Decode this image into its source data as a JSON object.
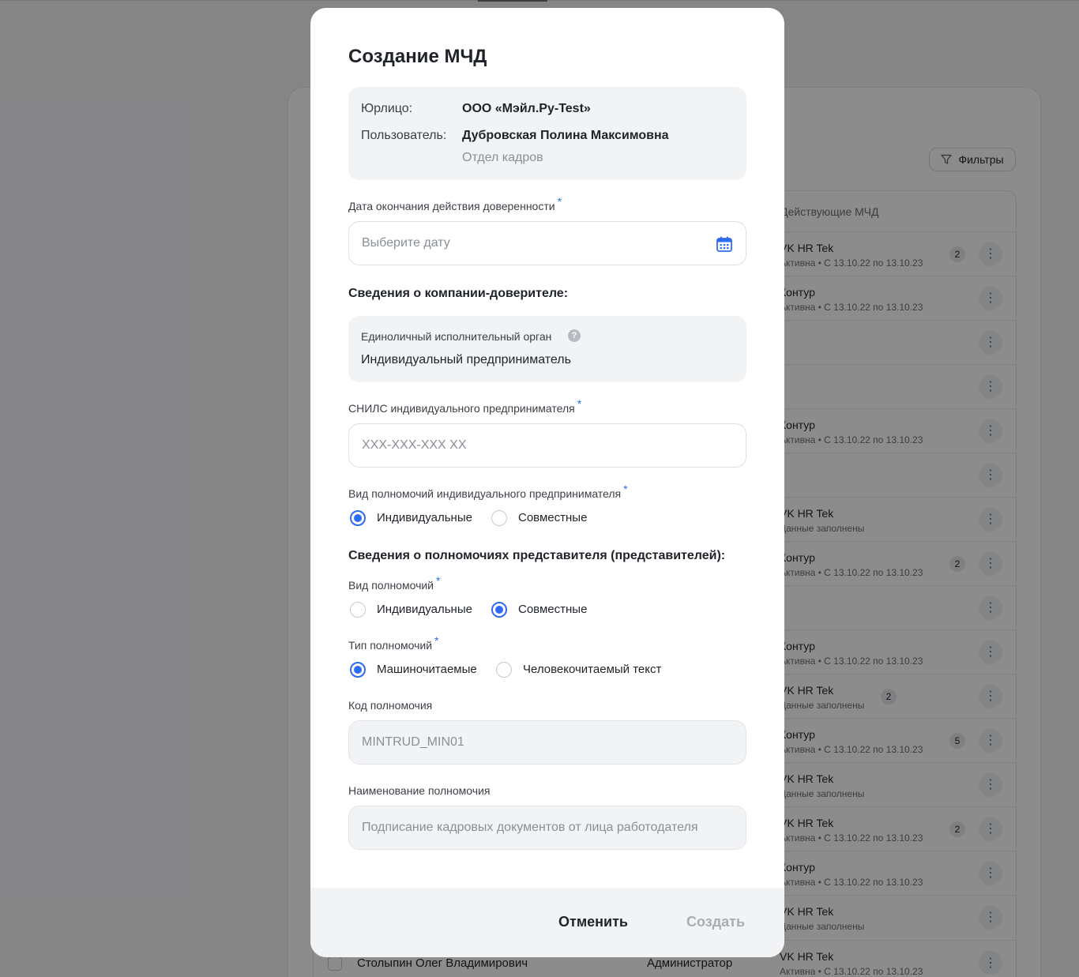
{
  "background": {
    "filter_label": "Фильтры",
    "column_header": "Действующие МЧД",
    "rows": [
      {
        "org": "VK HR Tek",
        "status": "Активна",
        "period": "С 13.10.22 по 13.10.23",
        "badge": "2"
      },
      {
        "org": "Контур",
        "status": "Активна",
        "period": "С 13.10.22 по 13.10.23",
        "badge": ""
      },
      {
        "org": "",
        "status": "",
        "period": "",
        "badge": ""
      },
      {
        "org": "",
        "status": "",
        "period": "",
        "badge": ""
      },
      {
        "org": "Контур",
        "status": "Активна",
        "period": "С 13.10.22 по 13.10.23",
        "badge": ""
      },
      {
        "org": "",
        "status": "",
        "period": "",
        "badge": ""
      },
      {
        "org": "VK HR Tek",
        "status": "Данные заполнены",
        "period": "",
        "badge": ""
      },
      {
        "org": "Контур",
        "status": "Активна",
        "period": "С 13.10.22 по 13.10.23",
        "badge": "2"
      },
      {
        "org": "",
        "status": "",
        "period": "",
        "badge": ""
      },
      {
        "org": "Контур",
        "status": "Активна",
        "period": "С 13.10.22 по 13.10.23",
        "badge": ""
      },
      {
        "org": "VK HR Tek",
        "status": "Данные заполнены",
        "period": "",
        "badge": "2"
      },
      {
        "org": "Контур",
        "status": "Активна",
        "period": "С 13.10.22 по 13.10.23",
        "badge": "5"
      },
      {
        "org": "VK HR Tek",
        "status": "Данные заполнены",
        "period": "",
        "badge": ""
      },
      {
        "org": "VK HR Tek",
        "status": "Активна",
        "period": "С 13.10.22 по 13.10.23",
        "badge": "2"
      },
      {
        "org": "Контур",
        "status": "Активна",
        "period": "С 13.10.22 по 13.10.23",
        "badge": ""
      },
      {
        "org": "VK HR Tek",
        "status": "Данные заполнены",
        "period": "",
        "badge": ""
      }
    ],
    "last_row": {
      "name": "Столыпин Олег Владимирович",
      "role": "Администратор",
      "org": "VK HR Tek",
      "status": "Активна",
      "period": "С 13.10.22 по 13.10.23"
    }
  },
  "modal": {
    "title": "Создание МЧД",
    "info": {
      "entity_label": "Юрлицо:",
      "entity_value": "ООО «Мэйл.Ру-Test»",
      "user_label": "Пользователь:",
      "user_value": "Дубровская Полина Максимовна",
      "department": "Отдел кадров"
    },
    "expiry": {
      "label": "Дата окончания действия доверенности",
      "required_mark": "*",
      "placeholder": "Выберите дату"
    },
    "principal_section_title": "Сведения о компании-доверителе:",
    "sole_body": {
      "label": "Единоличный исполнительный орган",
      "help": "?",
      "value": "Индивидуальный предприниматель"
    },
    "snils": {
      "label": "СНИЛС индивидуального предпринимателя",
      "required_mark": "*",
      "placeholder": "XXX-XXX-XXX XX"
    },
    "ip_powers_kind": {
      "label": "Вид полномочий индивидуального предпринимателя",
      "required_mark": "*",
      "options": [
        "Индивидуальные",
        "Совместные"
      ],
      "selected": "Индивидуальные"
    },
    "rep_section_title": "Сведения о полномочиях представителя (представителей):",
    "rep_powers_kind": {
      "label": "Вид полномочий",
      "required_mark": "*",
      "options": [
        "Индивидуальные",
        "Совместные"
      ],
      "selected": "Совместные"
    },
    "powers_type": {
      "label": "Тип полномочий",
      "required_mark": "*",
      "options": [
        "Машиночитаемые",
        "Человекочитаемый текст"
      ],
      "selected": "Машиночитаемые"
    },
    "power_code": {
      "label": "Код полномочия",
      "value": "MINTRUD_MIN01"
    },
    "power_name": {
      "label": "Наименование полномочия",
      "value": "Подписание кадровых документов от лица работодателя"
    },
    "footer": {
      "cancel_label": "Отменить",
      "create_label": "Создать"
    }
  }
}
